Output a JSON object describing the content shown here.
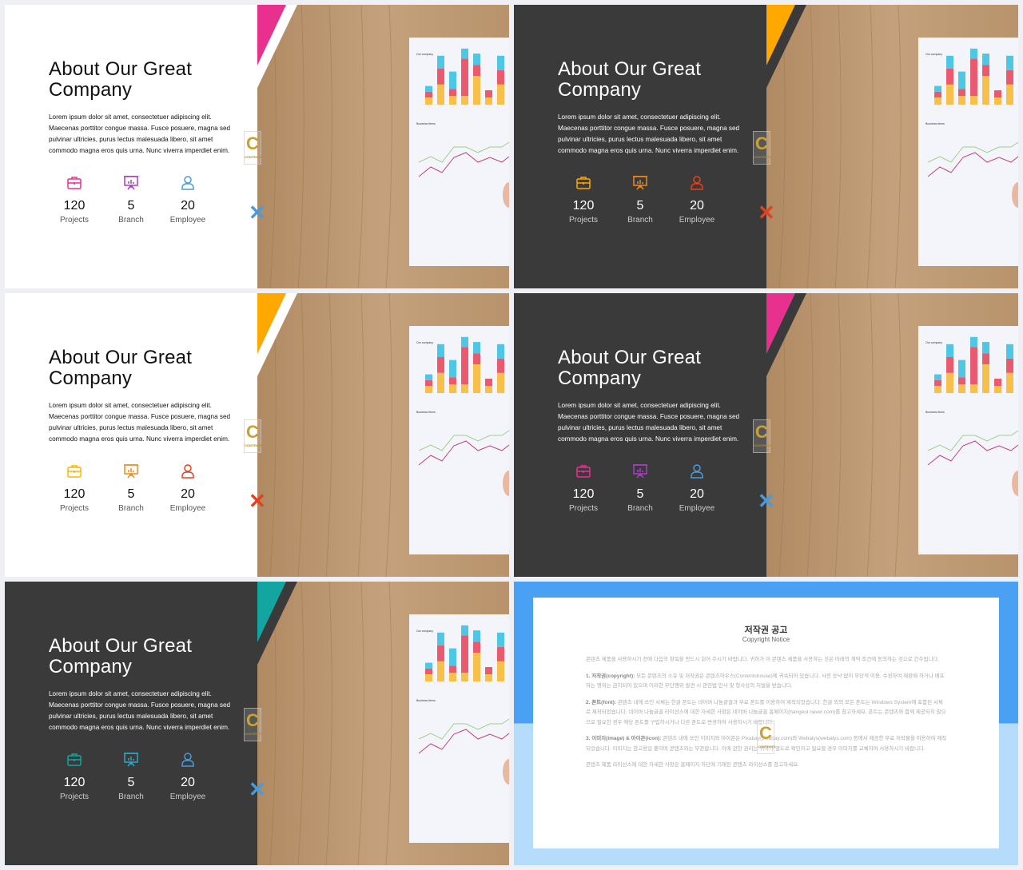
{
  "slides": [
    {
      "theme": "light",
      "accent": "#e8318f",
      "x_color": "#4a9bd8",
      "icon_colors": [
        "#e8318f",
        "#a83fc4",
        "#4a9bd8"
      ]
    },
    {
      "theme": "dark",
      "accent": "#ffa800",
      "x_color": "#e8401c",
      "icon_colors": [
        "#ffa800",
        "#f08a1e",
        "#e8401c"
      ]
    },
    {
      "theme": "light",
      "accent": "#ffa800",
      "x_color": "#e8401c",
      "icon_colors": [
        "#ffb400",
        "#f08a1e",
        "#e8401c"
      ]
    },
    {
      "theme": "dark",
      "accent": "#e8318f",
      "x_color": "#4a9bd8",
      "icon_colors": [
        "#e8318f",
        "#a83fc4",
        "#4a9bd8"
      ]
    },
    {
      "theme": "dark",
      "accent": "#13a6a0",
      "x_color": "#4a9bd8",
      "icon_colors": [
        "#13a6a0",
        "#2aa8c8",
        "#4a9bd8"
      ]
    }
  ],
  "content": {
    "title_line1": "About Our Great",
    "title_line2": "Company",
    "body": "Lorem ipsum dolor sit amet, consectetuer adipiscing elit. Maecenas porttitor congue massa. Fusce posuere, magna sed pulvinar ultricies, purus lectus malesuada libero, sit amet commodo magna eros quis urna. Nunc viverra imperdiet enim.",
    "stats": [
      {
        "icon": "briefcase-icon",
        "value": "120",
        "label": "Projects"
      },
      {
        "icon": "presentation-board-icon",
        "value": "5",
        "label": "Branch"
      },
      {
        "icon": "user-icon",
        "value": "20",
        "label": "Employee"
      }
    ],
    "photo_chart_titles": [
      "Our company",
      "Business Items"
    ]
  },
  "colors": {
    "dark_panel": "#3a3a3a",
    "light_panel": "#ffffff",
    "page_bg": "#eef0f5"
  },
  "copyright": {
    "title": "저작권 공고",
    "subtitle": "Copyright Notice",
    "intro": "콘텐츠 제품을 사용하시기 전에 다음의 항목을 반드시 읽어 주시기 바랍니다. 귀하가 이 콘텐츠 제품을 사용하는 것은 아래의 계약 조건에 동의하는 것으로 간주됩니다.",
    "items": [
      {
        "head": "1. 저작권(copyright):",
        "text": "모든 콘텐츠의 소유 및 저작권은 콘텐츠하우스(Contentshouse)에 귀속되어 있습니다. 사전 승낙 없이 무단적 이용, 수정하여 재판매 하거나 배포하는 행위는 금지되어 있으며 이러한 무단행위 발견 시 관련법 민사 및 형사상의 처벌을 받습니다."
      },
      {
        "head": "2. 폰트(font):",
        "text": "콘텐츠 내에 쓰인 서체는 한글 폰트는 네이버 나눔글꼴과 무료 폰트를 이용하여 제작되었습니다. 한글 외의 모든 폰트는 Windows System에 포함된 서체로 제작되었습니다. 네이버 나눔글꼴 라이선스에 대한 자세한 사항은 네이버 나눔글꼴 홈페이지(hangeul.naver.com)를 참고하세요. 폰트는 콘텐츠와 함께 제공되지 않으므로 필요한 경우 해당 폰트를 구입하시거나 다른 폰트로 변경하여 사용하시기 바랍니다."
      },
      {
        "head": "3. 이미지(image) & 아이콘(icon):",
        "text": "콘텐츠 내에 쓰인 이미지와 아이콘은 Pixabay(pixabay.com)와 Webalys(webalys.com) 등에서 제공한 무료 저작물을 이용하여 제작되었습니다. 이미지는 참고용일 뿐이며 콘텐츠와는 무관합니다. 이에 관한 권리는 귀하가 별도로 확인하고 필요할 경우 이미지를 교체하여 사용하시기 바랍니다."
      }
    ],
    "outro": "콘텐츠 제품 라이선스에 대한 자세한 사항은 홈페이지 하단에 기재된 콘텐츠 라이선스를 참고하세요.",
    "top_color": "#4aa0f2",
    "bottom_color": "#b5dcfb"
  }
}
